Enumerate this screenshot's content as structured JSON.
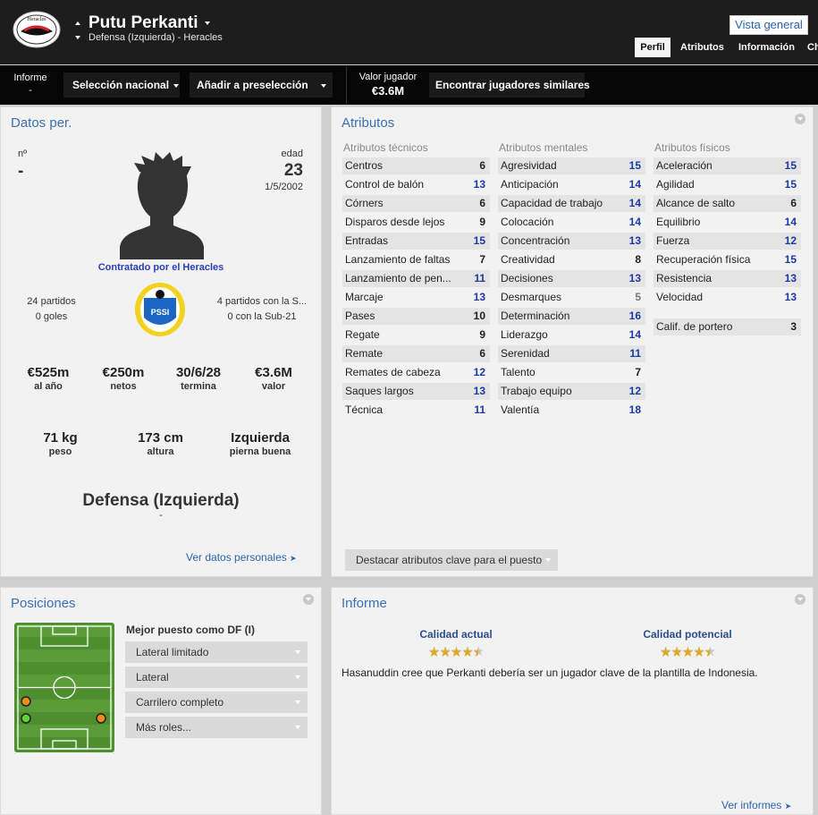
{
  "header": {
    "player_name": "Putu Perkanti",
    "subtitle": "Defensa (Izquierda) - Heracles",
    "club_logo_text": "Heracles",
    "vista_label": "Vista general",
    "tabs": [
      "Perfil",
      "Atributos",
      "Información",
      "Ch"
    ]
  },
  "toolbar": {
    "informe_label": "Informe",
    "informe_value": "-",
    "seleccion_label": "Selección nacional",
    "preseleccion_label": "Añadir a preselección",
    "valor_label": "Valor jugador",
    "valor_value": "€3.6M",
    "similares_label": "Encontrar jugadores similares"
  },
  "datos": {
    "title": "Datos per.",
    "number_label": "nº",
    "number_value": "-",
    "age_label": "edad",
    "age_value": "23",
    "dob": "1/5/2002",
    "contract_by": "Contratado por el Heracles",
    "left_stats": [
      "24 partidos",
      "0 goles"
    ],
    "right_stats": [
      "4 partidos con la S...",
      "0 con la Sub-21"
    ],
    "money": [
      {
        "v": "€525m",
        "l": "al año"
      },
      {
        "v": "€250m",
        "l": "netos"
      },
      {
        "v": "30/6/28",
        "l": "termina"
      },
      {
        "v": "€3.6M",
        "l": "valor"
      }
    ],
    "body": [
      {
        "v": "71 kg",
        "l": "peso"
      },
      {
        "v": "173 cm",
        "l": "altura"
      },
      {
        "v": "Izquierda",
        "l": "pierna buena"
      }
    ],
    "position": "Defensa (Izquierda)",
    "position_sub": "-",
    "link": "Ver datos personales"
  },
  "atributos": {
    "title": "Atributos",
    "col_heads": [
      "Atributos técnicos",
      "Atributos mentales",
      "Atributos físicos"
    ],
    "tecnicos": [
      {
        "n": "Centros",
        "v": "6"
      },
      {
        "n": "Control de balón",
        "v": "13"
      },
      {
        "n": "Córners",
        "v": "6"
      },
      {
        "n": "Disparos desde lejos",
        "v": "9"
      },
      {
        "n": "Entradas",
        "v": "15"
      },
      {
        "n": "Lanzamiento de faltas",
        "v": "7"
      },
      {
        "n": "Lanzamiento de pen...",
        "v": "11"
      },
      {
        "n": "Marcaje",
        "v": "13"
      },
      {
        "n": "Pases",
        "v": "10"
      },
      {
        "n": "Regate",
        "v": "9"
      },
      {
        "n": "Remate",
        "v": "6"
      },
      {
        "n": "Remates de cabeza",
        "v": "12"
      },
      {
        "n": "Saques largos",
        "v": "13"
      },
      {
        "n": "Técnica",
        "v": "11"
      }
    ],
    "mentales": [
      {
        "n": "Agresividad",
        "v": "15"
      },
      {
        "n": "Anticipación",
        "v": "14"
      },
      {
        "n": "Capacidad de trabajo",
        "v": "14"
      },
      {
        "n": "Colocación",
        "v": "14"
      },
      {
        "n": "Concentración",
        "v": "13"
      },
      {
        "n": "Creatividad",
        "v": "8"
      },
      {
        "n": "Decisiones",
        "v": "13"
      },
      {
        "n": "Desmarques",
        "v": "5"
      },
      {
        "n": "Determinación",
        "v": "16"
      },
      {
        "n": "Liderazgo",
        "v": "14"
      },
      {
        "n": "Serenidad",
        "v": "11"
      },
      {
        "n": "Talento",
        "v": "7"
      },
      {
        "n": "Trabajo equipo",
        "v": "12"
      },
      {
        "n": "Valentía",
        "v": "18"
      }
    ],
    "fisicos": [
      {
        "n": "Aceleración",
        "v": "15"
      },
      {
        "n": "Agilidad",
        "v": "15"
      },
      {
        "n": "Alcance de salto",
        "v": "6"
      },
      {
        "n": "Equilibrio",
        "v": "14"
      },
      {
        "n": "Fuerza",
        "v": "12"
      },
      {
        "n": "Recuperación física",
        "v": "15"
      },
      {
        "n": "Resistencia",
        "v": "13"
      },
      {
        "n": "Velocidad",
        "v": "13"
      }
    ],
    "portero": {
      "n": "Calif. de portero",
      "v": "3"
    },
    "highlight_button": "Destacar atributos clave para el puesto",
    "value_colors": {
      "high": "#1a3aa8",
      "mid": "#222222",
      "low": "#777777"
    }
  },
  "posiciones": {
    "title": "Posiciones",
    "best_label": "Mejor puesto como DF (I)",
    "roles": [
      "Lateral limitado",
      "Lateral",
      "Carrilero completo",
      "Más roles..."
    ]
  },
  "informe": {
    "title": "Informe",
    "actual_label": "Calidad actual",
    "potencial_label": "Calidad potencial",
    "actual_stars": 4.5,
    "potencial_stars": 4.5,
    "text": "Hasanuddin cree que Perkanti debería ser un jugador clave de la plantilla de Indonesia.",
    "link": "Ver informes"
  }
}
